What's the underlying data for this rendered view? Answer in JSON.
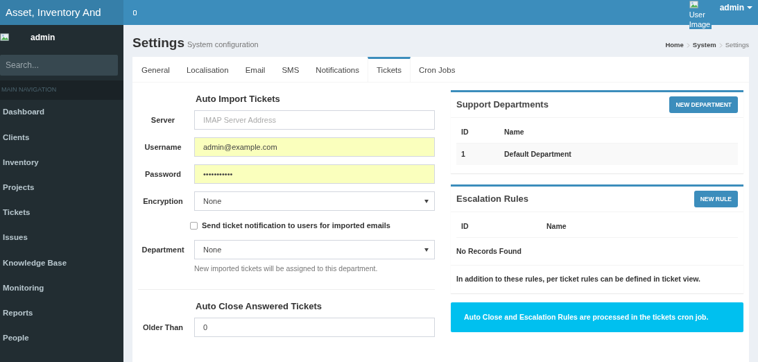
{
  "header": {
    "app_title": "Asset, Inventory And",
    "user_image_alt": "User Image",
    "user_name": "admin"
  },
  "sidebar": {
    "user_name": "admin",
    "search": {
      "placeholder": "Search..."
    },
    "section": "MAIN NAVIGATION",
    "items": [
      {
        "label": "Dashboard"
      },
      {
        "label": "Clients"
      },
      {
        "label": "Inventory"
      },
      {
        "label": "Projects"
      },
      {
        "label": "Tickets"
      },
      {
        "label": "Issues"
      },
      {
        "label": "Knowledge Base"
      },
      {
        "label": "Monitoring"
      },
      {
        "label": "Reports"
      },
      {
        "label": "People"
      }
    ]
  },
  "page": {
    "title": "Settings",
    "subtitle": "System configuration",
    "breadcrumb": [
      "Home",
      "System",
      "Settings"
    ]
  },
  "tabs": [
    {
      "label": "General",
      "selected": false
    },
    {
      "label": "Localisation",
      "selected": false
    },
    {
      "label": "Email",
      "selected": false
    },
    {
      "label": "SMS",
      "selected": false
    },
    {
      "label": "Notifications",
      "selected": false
    },
    {
      "label": "Tickets",
      "selected": true
    },
    {
      "label": "Cron Jobs",
      "selected": false
    }
  ],
  "auto_import": {
    "heading": "Auto Import Tickets",
    "fields": [
      {
        "kind": "text",
        "label": "Server",
        "placeholder": "IMAP Server Address"
      },
      {
        "kind": "text",
        "label": "Username",
        "value": "admin@example.com",
        "autofilled": true
      },
      {
        "kind": "text",
        "label": "Password",
        "value": "•••••••••••",
        "autofilled": true
      },
      {
        "kind": "select",
        "label": "Encryption",
        "value": "None"
      },
      {
        "kind": "checkbox",
        "label": "Send ticket notification to users for imported emails",
        "checked": false
      },
      {
        "kind": "select",
        "label": "Department",
        "value": "None",
        "help": "New imported tickets will be assigned to this department."
      }
    ]
  },
  "auto_close": {
    "heading": "Auto Close Answered Tickets",
    "fields": [
      {
        "label": "Older Than",
        "value": "0"
      }
    ]
  },
  "support_departments": {
    "title": "Support Departments",
    "button": "NEW DEPARTMENT",
    "columns": [
      "ID",
      "Name"
    ],
    "rows": [
      [
        "1",
        "Default Department"
      ]
    ]
  },
  "escalation_rules": {
    "title": "Escalation Rules",
    "button": "NEW RULE",
    "columns": [
      "ID",
      "Name"
    ],
    "empty": "No Records Found",
    "note": "In addition to these rules, per ticket rules can be defined in ticket view."
  },
  "info_callout": "Auto Close and Escalation Rules are processed in the tickets cron job."
}
